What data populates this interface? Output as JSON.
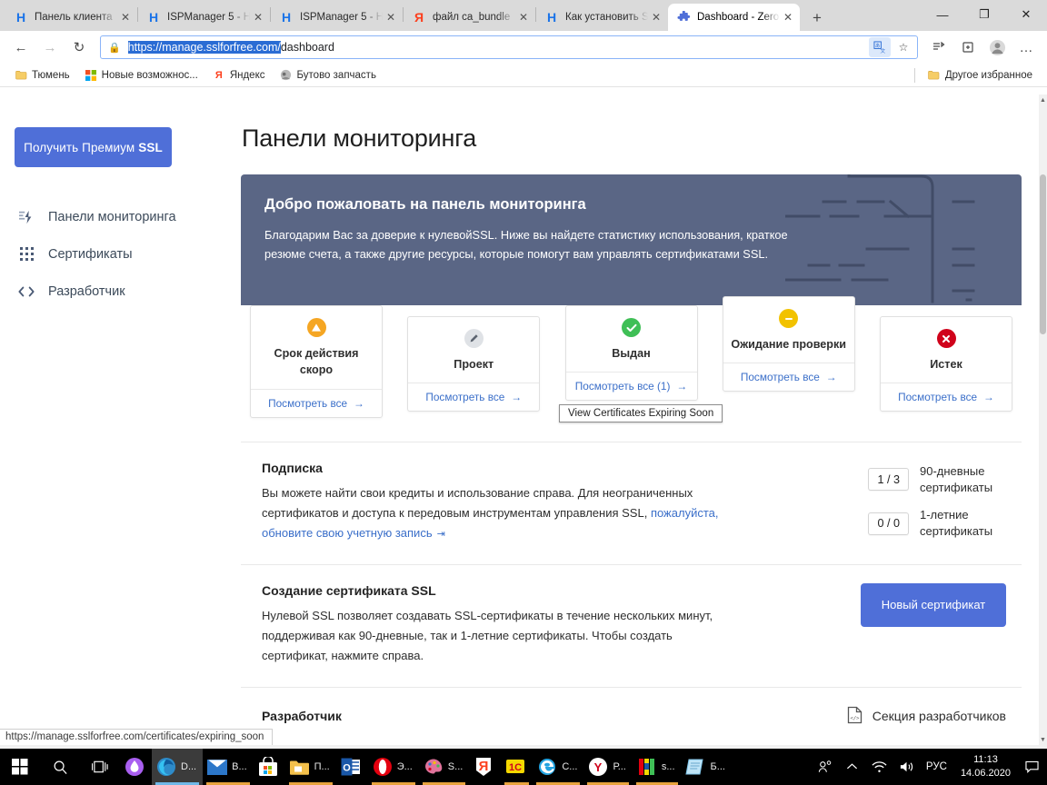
{
  "browser": {
    "tabs": [
      {
        "title": "Панель клиента",
        "favicon": "H",
        "favicon_color": "#1a73e8",
        "active": false
      },
      {
        "title": "ISPManager 5 - Н",
        "favicon": "H",
        "favicon_color": "#1a73e8",
        "active": false
      },
      {
        "title": "ISPManager 5 - Н",
        "favicon": "H",
        "favicon_color": "#1a73e8",
        "active": false
      },
      {
        "title": "файл ca_bundle",
        "favicon": "Я",
        "favicon_color": "#fc3f1d",
        "active": false
      },
      {
        "title": "Как установить S",
        "favicon": "H",
        "favicon_color": "#1a73e8",
        "active": false
      },
      {
        "title": "Dashboard - Zero",
        "favicon": "puzzle",
        "favicon_color": "#4f6fd8",
        "active": true
      }
    ],
    "newtab_label": "+",
    "window_controls": {
      "minimize": "—",
      "restore": "❐",
      "close": "✕"
    },
    "nav": {
      "back": "←",
      "forward": "→",
      "reload": "↻"
    },
    "address": {
      "lock_icon": "lock-icon",
      "selected_part": "https://manage.sslforfree.com/",
      "rest_part": "dashboard",
      "translate_icon": "translate-icon",
      "favorite_icon": "star-icon"
    },
    "toolbar_icons": {
      "collections": "collections-icon",
      "favorites_hub": "favorites-hub-icon",
      "profile": "profile-icon",
      "settings_more": "…"
    },
    "bookmarks": [
      {
        "label": "Тюмень",
        "icon": "folder-icon"
      },
      {
        "label": "Новые возможнос...",
        "icon": "microsoft-icon"
      },
      {
        "label": "Яндекс",
        "icon": "yandex-icon"
      },
      {
        "label": "Бутово запчасть",
        "icon": "site-icon"
      }
    ],
    "bookmarks_other": {
      "label": "Другое избранное",
      "icon": "folder-icon"
    },
    "status_url": "https://manage.sslforfree.com/certificates/expiring_soon"
  },
  "sidebar": {
    "premium_button": {
      "text": "Получить Премиум",
      "emphasis": "SSL"
    },
    "items": [
      {
        "label": "Панели мониторинга",
        "icon": "dashboard-icon"
      },
      {
        "label": "Сертификаты",
        "icon": "grid-icon"
      },
      {
        "label": "Разработчик",
        "icon": "code-icon"
      }
    ]
  },
  "page": {
    "title": "Панели мониторинга",
    "banner": {
      "heading": "Добро пожаловать на панель мониторинга",
      "body": "Благодарим Вас за доверие к нулевойSSL. Ниже вы найдете статистику использования, краткое резюме счета, а также другие ресурсы, которые помогут вам управлять сертификатами SSL.",
      "bg_color": "#5a6685"
    },
    "status_cards": [
      {
        "label": "Срок действия скоро",
        "icon": "warning-triangle-icon",
        "icon_color": "#f5a623",
        "link": "Посмотреть все",
        "arrow": "→",
        "raised": true
      },
      {
        "label": "Проект",
        "icon": "pencil-icon",
        "icon_color": "#b9bec6",
        "link": "Посмотреть все",
        "arrow": "→",
        "raised": false
      },
      {
        "label": "Выдан",
        "icon": "check-circle-icon",
        "icon_color": "#3fbf56",
        "link": "Посмотреть все (1)",
        "arrow": "→",
        "raised": true
      },
      {
        "label": "Ожидание проверки",
        "icon": "minus-circle-icon",
        "icon_color": "#f2c200",
        "link": "Посмотреть все",
        "arrow": "→",
        "raised": true
      },
      {
        "label": "Истек",
        "icon": "x-circle-icon",
        "icon_color": "#d0021b",
        "link": "Посмотреть все",
        "arrow": "→",
        "raised": false
      }
    ],
    "tooltip": "View Certificates Expiring Soon",
    "subscription": {
      "heading": "Подписка",
      "body_before": "Вы можете найти свои кредиты и использование справа. Для неограниченных сертификатов и доступа к передовым инструментам управления SSL, ",
      "link": "пожалуйста, обновите свою учетную запись",
      "external_icon": "external-link-icon",
      "credits": [
        {
          "value": "1 / 3",
          "label": "90-дневные сертификаты"
        },
        {
          "value": "0 / 0",
          "label": "1-летние сертификаты"
        }
      ]
    },
    "create_ssl": {
      "heading": "Создание сертификата SSL",
      "body": "Нулевой SSL позволяет создавать SSL-сертификаты в течение нескольких минут, поддерживая как 90-дневные, так и 1-летние сертификаты. Чтобы создать сертификат, нажмите справа.",
      "button": "Новый сертификат"
    },
    "developer": {
      "heading": "Разработчик",
      "link": "Секция разработчиков",
      "icon": "code-file-icon"
    },
    "accent_color": "#4f6fd8",
    "link_color": "#3b6fc9"
  },
  "taskbar": {
    "start_icon": "windows-start-icon",
    "search_icon": "search-icon",
    "taskview_icon": "task-view-icon",
    "items": [
      {
        "label": "",
        "icon": "drop-icon",
        "color": "#b05cf0",
        "active": false,
        "running": false
      },
      {
        "label": "D...",
        "icon": "edge-icon",
        "color": "#2e8bc9",
        "active": true,
        "running": true
      },
      {
        "label": "В...",
        "icon": "mail-icon",
        "color": "#1a73e8",
        "active": false,
        "running": true
      },
      {
        "label": "",
        "icon": "store-icon",
        "color": "#ffffff",
        "active": false,
        "running": false
      },
      {
        "label": "П...",
        "icon": "explorer-icon",
        "color": "#f3c04b",
        "active": false,
        "running": true
      },
      {
        "label": "",
        "icon": "outlook-icon",
        "color": "#1a57a8",
        "active": false,
        "running": false
      },
      {
        "label": "Э...",
        "icon": "opera-icon",
        "color": "#e3000f",
        "active": false,
        "running": true
      },
      {
        "label": "S...",
        "icon": "paint-icon",
        "color": "#d86a9a",
        "active": false,
        "running": false
      },
      {
        "label": "",
        "icon": "yandex-icon",
        "color": "#fc3f1d",
        "active": false,
        "running": false
      },
      {
        "label": "",
        "icon": "1c-icon",
        "color": "#f5d800",
        "active": false,
        "running": true
      },
      {
        "label": "С...",
        "icon": "ie-icon",
        "color": "#23a3e0",
        "active": false,
        "running": true
      },
      {
        "label": "Р...",
        "icon": "ybrowser-icon",
        "color": "#ffffff",
        "active": false,
        "running": true
      },
      {
        "label": "s...",
        "icon": "winrar-icon",
        "color": "#8e44ad",
        "active": false,
        "running": true
      },
      {
        "label": "Б...",
        "icon": "notepad-icon",
        "color": "#63b7e8",
        "active": false,
        "running": false
      }
    ],
    "tray": {
      "people_icon": "people-icon",
      "chevron_icon": "show-hidden-icons-icon",
      "network_icon": "wifi-icon",
      "volume_icon": "volume-icon",
      "language": "РУС",
      "time": "11:13",
      "date": "14.06.2020",
      "notifications_icon": "notifications-icon"
    }
  }
}
